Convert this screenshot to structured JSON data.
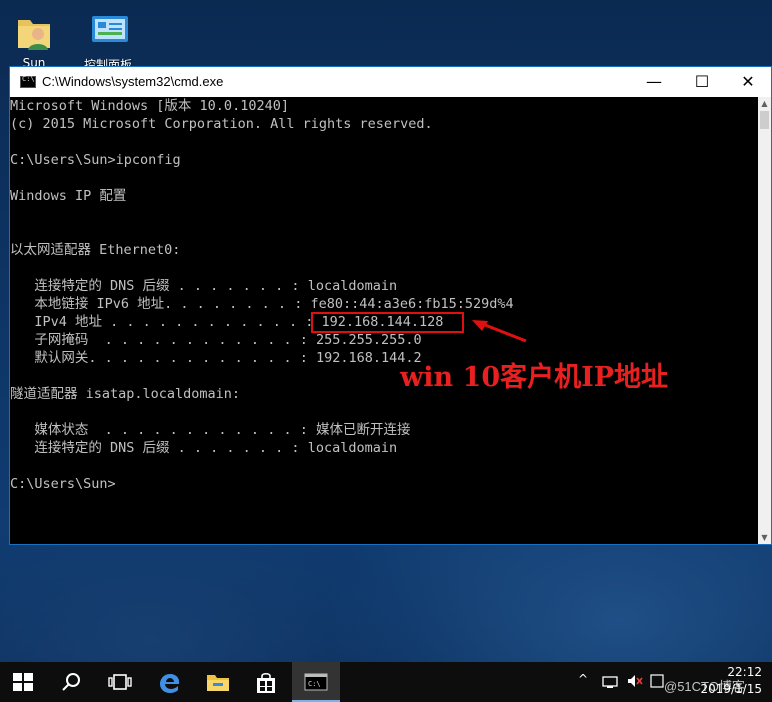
{
  "desktop": {
    "icons": [
      {
        "label": "Sun"
      },
      {
        "label": "控制面板"
      }
    ]
  },
  "window": {
    "title": "C:\\Windows\\system32\\cmd.exe",
    "minimize": "—",
    "maximize": "☐",
    "close": "✕"
  },
  "console": {
    "lines": [
      "Microsoft Windows [版本 10.0.10240]",
      "(c) 2015 Microsoft Corporation. All rights reserved.",
      "",
      "C:\\Users\\Sun>ipconfig",
      "",
      "Windows IP 配置",
      "",
      "",
      "以太网适配器 Ethernet0:",
      "",
      "   连接特定的 DNS 后缀 . . . . . . . : localdomain",
      "   本地链接 IPv6 地址. . . . . . . . : fe80::44:a3e6:fb15:529d%4",
      "   IPv4 地址 . . . . . . . . . . . . : 192.168.144.128",
      "   子网掩码  . . . . . . . . . . . . : 255.255.255.0",
      "   默认网关. . . . . . . . . . . . . : 192.168.144.2",
      "",
      "隧道适配器 isatap.localdomain:",
      "",
      "   媒体状态  . . . . . . . . . . . . : 媒体已断开连接",
      "   连接特定的 DNS 后缀 . . . . . . . : localdomain",
      "",
      "C:\\Users\\Sun>"
    ]
  },
  "annotation": {
    "text": "win 10客户机IP地址",
    "color": "#e82020"
  },
  "taskbar": {
    "clock_time": "22:12",
    "clock_date": "2019/1/15",
    "tray_chevron": "^"
  },
  "watermark": "@51CTO博客",
  "colors": {
    "console_text": "#c0c0c0",
    "console_bg": "#000000",
    "accent": "#1a6fbf",
    "highlight": "#e01010"
  }
}
